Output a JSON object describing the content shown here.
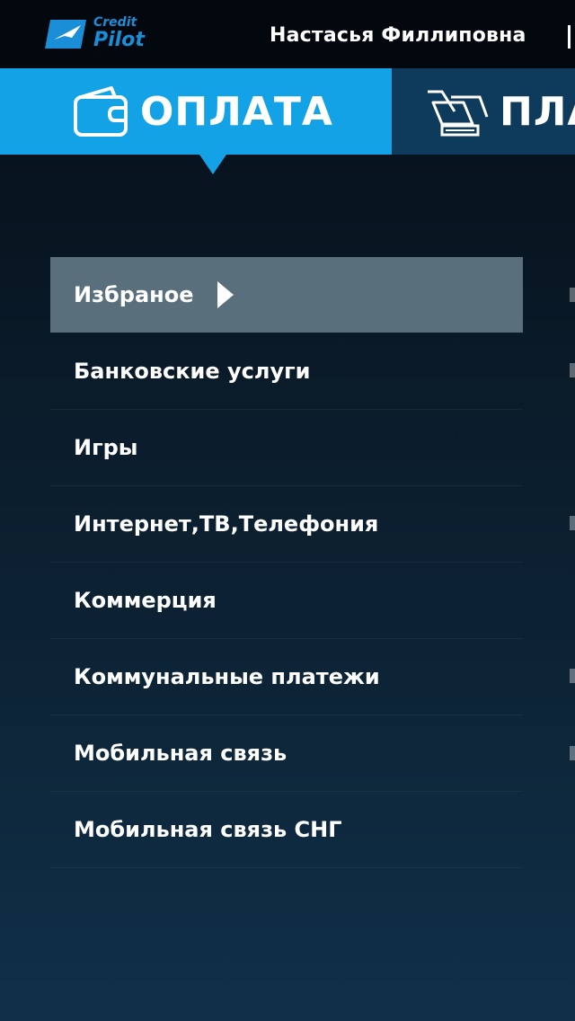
{
  "logo": {
    "line1": "Credit",
    "line2": "Pilot"
  },
  "user": {
    "name": "Настасья Филлиповна"
  },
  "tabs": [
    {
      "label": "ОПЛАТА",
      "icon": "wallet-icon",
      "active": true
    },
    {
      "label": "ПЛА",
      "icon": "payment-device-icon",
      "active": false
    }
  ],
  "menu": {
    "items": [
      {
        "label": "Избраное",
        "active": true
      },
      {
        "label": "Банковские услуги"
      },
      {
        "label": "Игры"
      },
      {
        "label": "Интернет,ТВ,Телефония"
      },
      {
        "label": "Коммерция"
      },
      {
        "label": "Коммунальные платежи"
      },
      {
        "label": "Мобильная связь"
      },
      {
        "label": "Мобильная связь СНГ"
      }
    ]
  },
  "colors": {
    "accent": "#14a2e6",
    "tab_inactive": "#0e3a5c",
    "active_item": "#5a6f7c",
    "topbar": "#03080e"
  }
}
